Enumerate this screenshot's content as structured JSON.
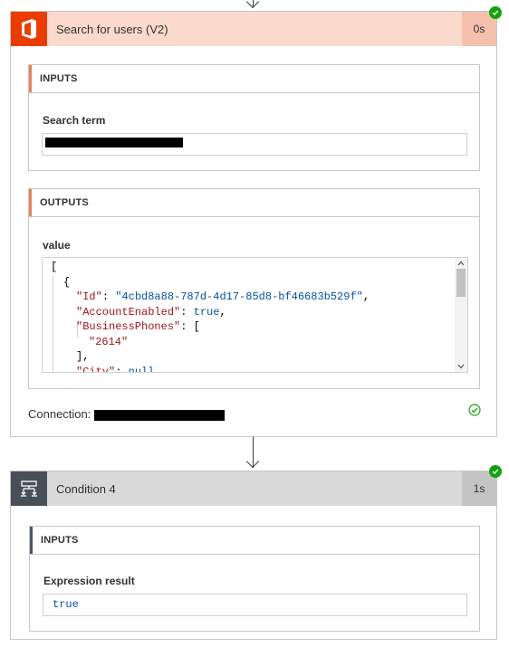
{
  "colors": {
    "office_orange": "#eb3c00",
    "search_header_bg": "#fbd9cd",
    "search_duration_bg": "#f5c0ad",
    "condition_header_bg": "#d9d9d9",
    "condition_icon_bg": "#484f58",
    "condition_duration_bg": "#c4c4c4",
    "success_green": "#13a10e",
    "search_accent": "#e8805a",
    "condition_accent": "#4c5566"
  },
  "search_card": {
    "title": "Search for users (V2)",
    "duration": "0s",
    "icon": "office-icon",
    "inputs": {
      "section_label": "INPUTS",
      "field_label": "Search term"
    },
    "outputs": {
      "section_label": "OUTPUTS",
      "field_label": "value",
      "json_lines": [
        [
          "["
        ],
        [
          "{"
        ],
        [
          "\"Id\"",
          ": ",
          "\"4cbd8a88-787d-4d17-85d8-bf46683b529f\"",
          ","
        ],
        [
          "\"AccountEnabled\"",
          ": ",
          "true",
          ","
        ],
        [
          "\"BusinessPhones\"",
          ": ",
          "["
        ],
        [
          "\"2614\""
        ],
        [
          "]",
          ","
        ],
        [
          "\"City\"",
          ": ",
          "null"
        ]
      ]
    },
    "connection_label": "Connection:"
  },
  "condition_card": {
    "title": "Condition 4",
    "duration": "1s",
    "icon": "condition-icon",
    "inputs": {
      "section_label": "INPUTS",
      "field_label": "Expression result",
      "value": "true"
    }
  }
}
